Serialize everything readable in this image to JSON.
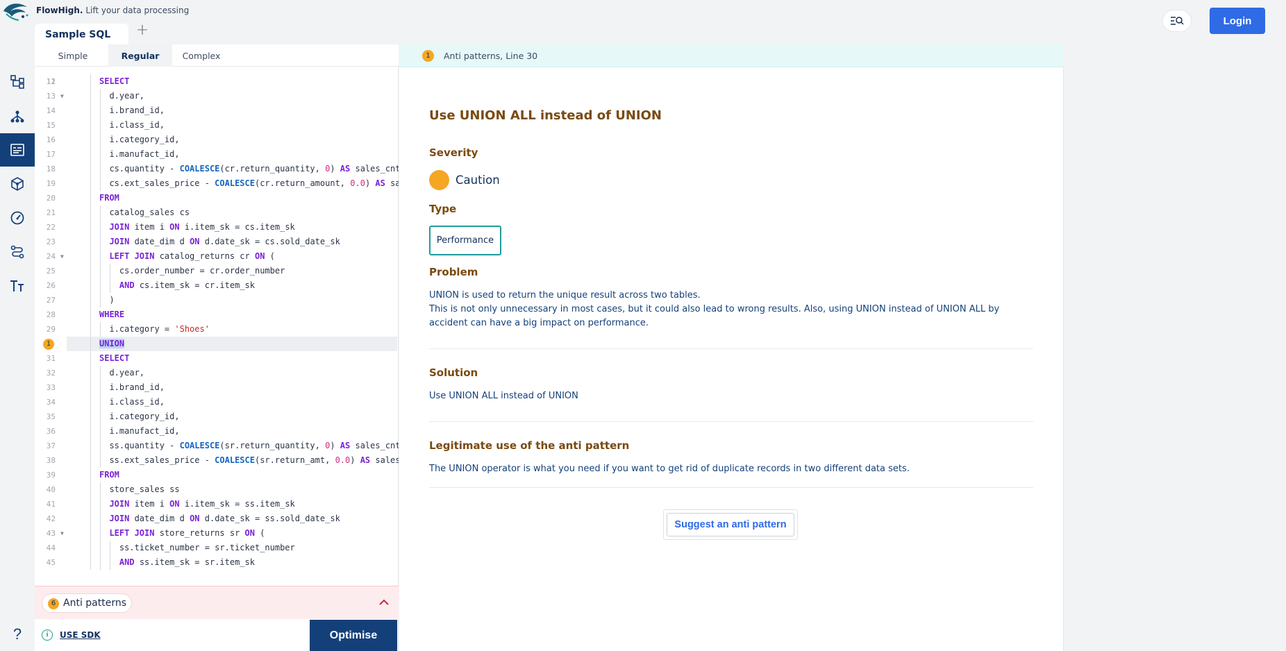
{
  "app": {
    "name": "FlowHigh.",
    "tagline": "Lift your data processing"
  },
  "header": {
    "tab_label": "Sample SQL",
    "add_tab": "+",
    "login_label": "Login"
  },
  "rail": {
    "items": [
      "tree-icon",
      "hierarchy-icon",
      "report-icon",
      "cube-icon",
      "gauge-icon",
      "route-icon",
      "text-format-icon"
    ],
    "help": "?"
  },
  "editor": {
    "subtabs": [
      "Simple",
      "Regular",
      "Complex"
    ],
    "active_subtab": "Regular",
    "first_partial_line": "11",
    "lines": [
      {
        "n": "12",
        "html": "<span class=\"kw\">SELECT</span>"
      },
      {
        "n": "13",
        "html": "  d.year,"
      },
      {
        "n": "14",
        "html": "  i.brand_id,"
      },
      {
        "n": "15",
        "html": "  i.class_id,"
      },
      {
        "n": "16",
        "html": "  i.category_id,"
      },
      {
        "n": "17",
        "html": "  i.manufact_id,"
      },
      {
        "n": "18",
        "html": "  cs.quantity - <span class=\"fn\">COALESCE</span>(cr.return_quantity, <span class=\"num\">0</span>) <span class=\"kw\">AS</span> sales_cnt"
      },
      {
        "n": "19",
        "html": "  cs.ext_sales_price - <span class=\"fn\">COALESCE</span>(cr.return_amount, <span class=\"num\">0.0</span>) <span class=\"kw\">AS</span> sa"
      },
      {
        "n": "20",
        "html": "<span class=\"kw\">FROM</span>"
      },
      {
        "n": "21",
        "html": "  catalog_sales cs"
      },
      {
        "n": "22",
        "html": "  <span class=\"kw\">JOIN</span> item i <span class=\"kw\">ON</span> i.item_sk = cs.item_sk"
      },
      {
        "n": "23",
        "html": "  <span class=\"kw\">JOIN</span> date_dim d <span class=\"kw\">ON</span> d.date_sk = cs.sold_date_sk"
      },
      {
        "n": "24",
        "fold": true,
        "html": "  <span class=\"kw\">LEFT JOIN</span> catalog_returns cr <span class=\"kw\">ON</span> ("
      },
      {
        "n": "25",
        "html": "    cs.order_number = cr.order_number"
      },
      {
        "n": "26",
        "html": "    <span class=\"kw\">AND</span> cs.item_sk = cr.item_sk"
      },
      {
        "n": "27",
        "html": "  )"
      },
      {
        "n": "28",
        "html": "<span class=\"kw\">WHERE</span>"
      },
      {
        "n": "29",
        "html": "  i.category = <span class=\"str\">'Shoes'</span>"
      },
      {
        "n": "30",
        "marker": "1",
        "hl": true,
        "html": "<span class=\"kw sel\">UNION</span>"
      },
      {
        "n": "31",
        "html": "<span class=\"kw\">SELECT</span>"
      },
      {
        "n": "32",
        "html": "  d.year,"
      },
      {
        "n": "33",
        "html": "  i.brand_id,"
      },
      {
        "n": "34",
        "html": "  i.class_id,"
      },
      {
        "n": "35",
        "html": "  i.category_id,"
      },
      {
        "n": "36",
        "html": "  i.manufact_id,"
      },
      {
        "n": "37",
        "html": "  ss.quantity - <span class=\"fn\">COALESCE</span>(sr.return_quantity, <span class=\"num\">0</span>) <span class=\"kw\">AS</span> sales_cnt"
      },
      {
        "n": "38",
        "html": "  ss.ext_sales_price - <span class=\"fn\">COALESCE</span>(sr.return_amt, <span class=\"num\">0.0</span>) <span class=\"kw\">AS</span> sales"
      },
      {
        "n": "39",
        "html": "<span class=\"kw\">FROM</span>"
      },
      {
        "n": "40",
        "html": "  store_sales ss"
      },
      {
        "n": "41",
        "html": "  <span class=\"kw\">JOIN</span> item i <span class=\"kw\">ON</span> i.item_sk = ss.item_sk"
      },
      {
        "n": "42",
        "html": "  <span class=\"kw\">JOIN</span> date_dim d <span class=\"kw\">ON</span> d.date_sk = ss.sold_date_sk"
      },
      {
        "n": "43",
        "fold": true,
        "html": "  <span class=\"kw\">LEFT JOIN</span> store_returns sr <span class=\"kw\">ON</span> ("
      },
      {
        "n": "44",
        "html": "    ss.ticket_number = sr.ticket_number"
      },
      {
        "n": "45",
        "html": "    <span class=\"kw\">AND</span> ss.item_sk = sr.item_sk"
      }
    ],
    "anti_patterns_count": "6",
    "anti_patterns_label": "Anti patterns",
    "sdk_label": "USE SDK",
    "optimise_label": "Optimise"
  },
  "detail": {
    "header_badge": "1",
    "header_text": "Anti patterns, Line 30",
    "title": "Use UNION ALL instead of UNION",
    "severity_heading": "Severity",
    "severity_value": "Caution",
    "severity_color": "#f5a623",
    "type_heading": "Type",
    "type_value": "Performance",
    "problem_heading": "Problem",
    "problem_line1": "UNION is used to return the unique result across two tables.",
    "problem_line2": "This is not only unnecessary in most cases, but it could also lead to wrong results. Also, using UNION instead of UNION ALL by accident can have a big impact on performance.",
    "solution_heading": "Solution",
    "solution_text": "Use UNION ALL instead of UNION",
    "legit_heading": "Legitimate use of the anti pattern",
    "legit_text": "The UNION operator is what you need if you want to get rid of duplicate records in two different data sets.",
    "suggest_label": "Suggest an anti pattern"
  }
}
